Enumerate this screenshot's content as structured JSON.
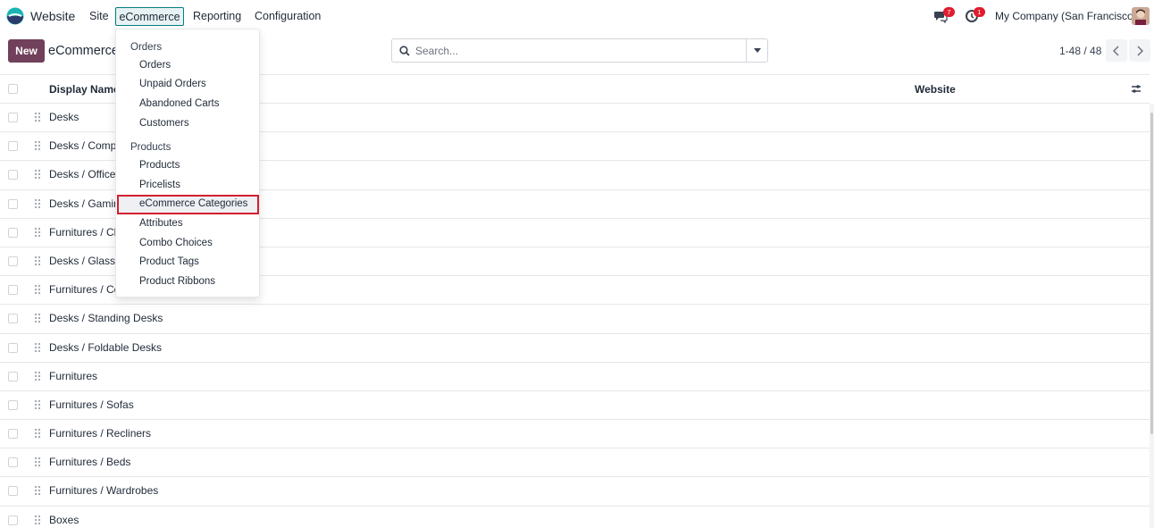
{
  "navbar": {
    "app_name": "Website",
    "menus": [
      "Site",
      "eCommerce",
      "Reporting",
      "Configuration"
    ],
    "active_menu": "eCommerce",
    "messages_badge": "7",
    "activities_badge": "1",
    "company": "My Company (San Francisco)"
  },
  "control_panel": {
    "new_label": "New",
    "title": "eCommerce",
    "search_placeholder": "Search...",
    "pager": "1-48 / 48"
  },
  "list": {
    "columns": [
      "Display Name",
      "Website"
    ],
    "rows": [
      "Desks",
      "Desks / Compo",
      "Desks / Office",
      "Desks / Gaming",
      "Furnitures / Ch",
      "Desks / Glass D",
      "Furnitures / Co",
      "Desks / Standing Desks",
      "Desks / Foldable Desks",
      "Furnitures",
      "Furnitures / Sofas",
      "Furnitures / Recliners",
      "Furnitures / Beds",
      "Furnitures / Wardrobes",
      "Boxes"
    ]
  },
  "dropdown": {
    "orders_section": "Orders",
    "orders_items": [
      "Orders",
      "Unpaid Orders",
      "Abandoned Carts",
      "Customers"
    ],
    "products_section": "Products",
    "products_items": [
      "Products",
      "Pricelists",
      "eCommerce Categories",
      "Attributes",
      "Combo Choices",
      "Product Tags",
      "Product Ribbons"
    ],
    "highlighted": "eCommerce Categories"
  },
  "colors": {
    "brand": "#71405b",
    "active_menu_border": "#017e84",
    "highlight_border": "#d3202f",
    "badge": "#e11d2f"
  },
  "icons": [
    "website-logo-icon",
    "chat-icon",
    "clock-icon",
    "search-icon",
    "caret-down-icon",
    "chevron-left-icon",
    "chevron-right-icon",
    "settings-sliders-icon",
    "drag-handle-icon"
  ]
}
